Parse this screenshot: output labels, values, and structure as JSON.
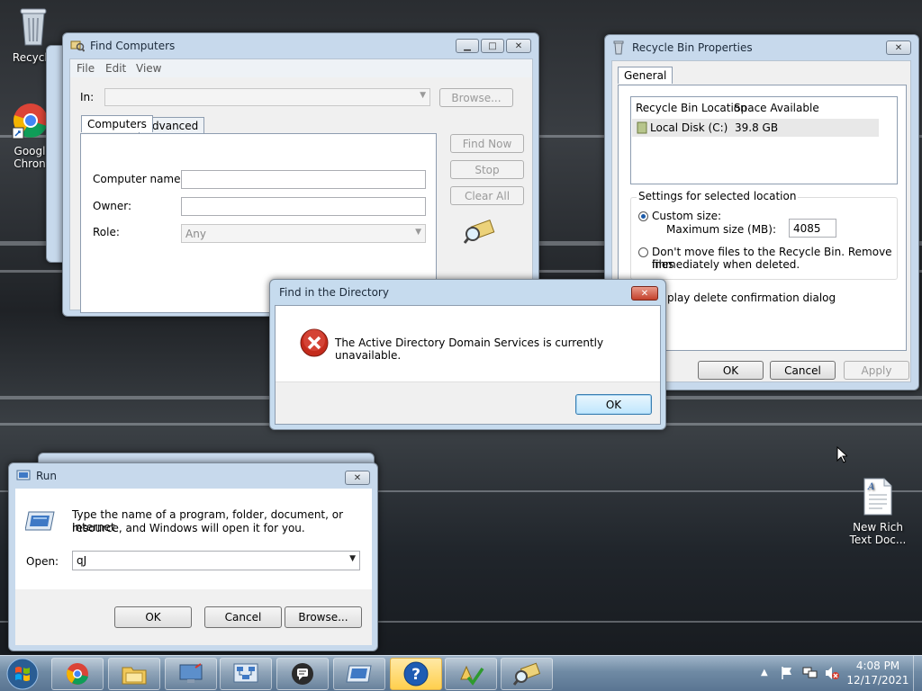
{
  "desktop": {
    "recycle_label": "Recycle",
    "chrome_label_1": "Googl",
    "chrome_label_2": "Chron",
    "rtf_label_1": "New Rich",
    "rtf_label_2": "Text Doc..."
  },
  "find_computers": {
    "title": "Find Computers",
    "menu": [
      "File",
      "Edit",
      "View"
    ],
    "in_label": "In:",
    "in_value": "",
    "browse_label": "Browse...",
    "tabs": [
      "Computers",
      "Advanced"
    ],
    "computer_name_label": "Computer name:",
    "owner_label": "Owner:",
    "role_label": "Role:",
    "role_value": "Any",
    "find_now_label": "Find Now",
    "stop_label": "Stop",
    "clear_all_label": "Clear All"
  },
  "recycle_props": {
    "title": "Recycle Bin Properties",
    "tab_general": "General",
    "col_location": "Recycle Bin Location",
    "col_space": "Space Available",
    "row_location": "Local Disk (C:)",
    "row_space": "39.8 GB",
    "settings_label": "Settings for selected location",
    "custom_size_label": "Custom size:",
    "max_size_label": "Maximum size (MB):",
    "max_size_value": "4085",
    "dont_move_line1": "Don't move files to the Recycle Bin. Remove files",
    "dont_move_line2": "immediately when deleted.",
    "display_confirm_text": "play delete confirmation dialog",
    "ok_label": "OK",
    "cancel_label": "Cancel",
    "apply_label": "Apply"
  },
  "error_dialog": {
    "title": "Find in the Directory",
    "message": "The Active Directory Domain Services is currently unavailable.",
    "ok_label": "OK"
  },
  "run_dialog": {
    "title": "Run",
    "description_line1": "Type the name of a program, folder, document, or Internet",
    "description_line2": "resource, and Windows will open it for you.",
    "open_label": "Open:",
    "open_value": "qJ",
    "ok_label": "OK",
    "cancel_label": "Cancel",
    "browse_label": "Browse..."
  },
  "taskbar": {
    "time": "4:08 PM",
    "date": "12/17/2021",
    "apps": [
      "chrome-icon",
      "explorer-icon",
      "remote-desktop-icon",
      "network-icon",
      "feedback-icon",
      "run-icon",
      "help-icon",
      "checklist-icon",
      "find-icon"
    ]
  }
}
